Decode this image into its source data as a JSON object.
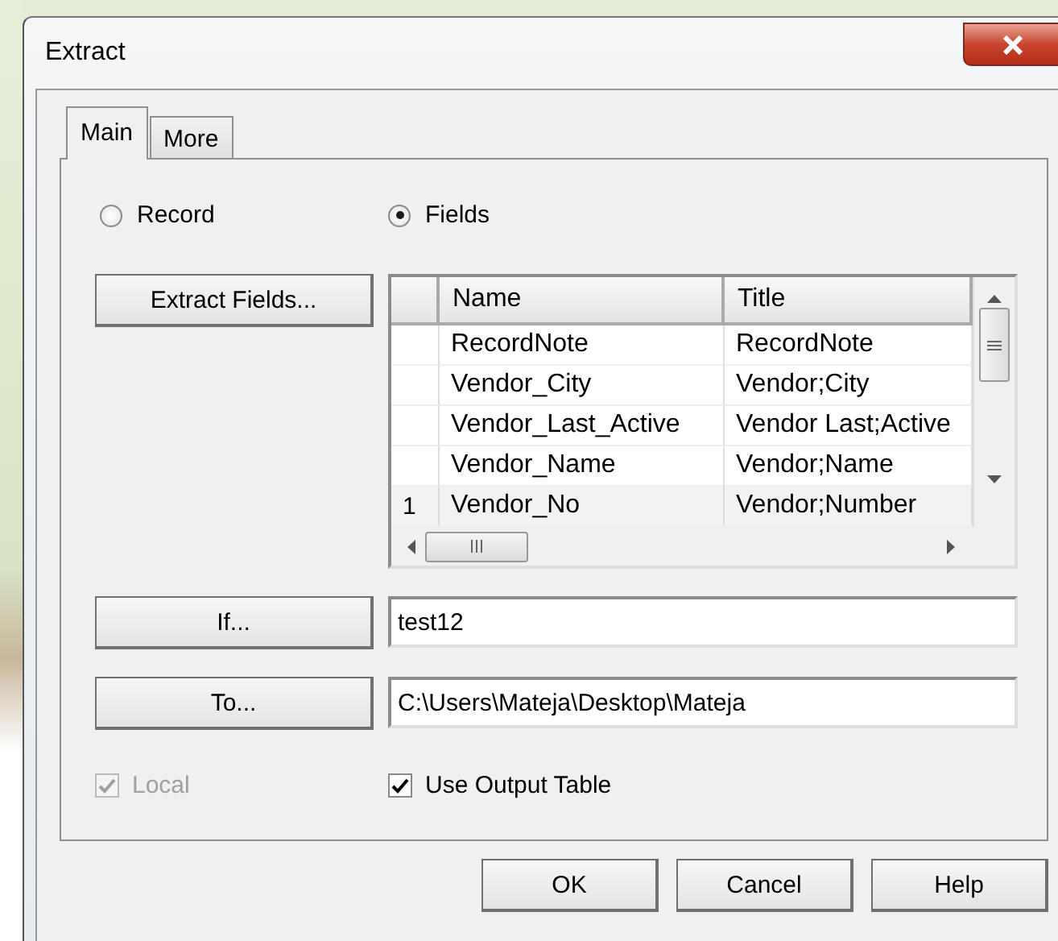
{
  "window": {
    "title": "Extract"
  },
  "tabs": [
    {
      "label": "Main",
      "selected": true
    },
    {
      "label": "More",
      "selected": false
    }
  ],
  "output_mode": [
    {
      "label": "Record",
      "selected": false
    },
    {
      "label": "Fields",
      "selected": true
    }
  ],
  "extract_fields_button": "Extract Fields...",
  "fields_table": {
    "columns": [
      "Name",
      "Title"
    ],
    "rows": [
      {
        "name": "RecordNote",
        "title": "RecordNote"
      },
      {
        "name": "Vendor_City",
        "title": "Vendor;City"
      },
      {
        "name": "Vendor_Last_Active",
        "title": "Vendor Last;Active"
      },
      {
        "name": "Vendor_Name",
        "title": "Vendor;Name"
      },
      {
        "row_header": "1",
        "name": "Vendor_No",
        "title": "Vendor;Number"
      }
    ]
  },
  "if_button": "If...",
  "if_value": "test12",
  "to_button": "To...",
  "to_value": "C:\\Users\\Mateja\\Desktop\\Mateja",
  "checkboxes": [
    {
      "label": "Local",
      "checked": true,
      "disabled": true
    },
    {
      "label": "Use Output Table",
      "checked": true,
      "disabled": false
    }
  ],
  "buttons": [
    "OK",
    "Cancel",
    "Help"
  ]
}
